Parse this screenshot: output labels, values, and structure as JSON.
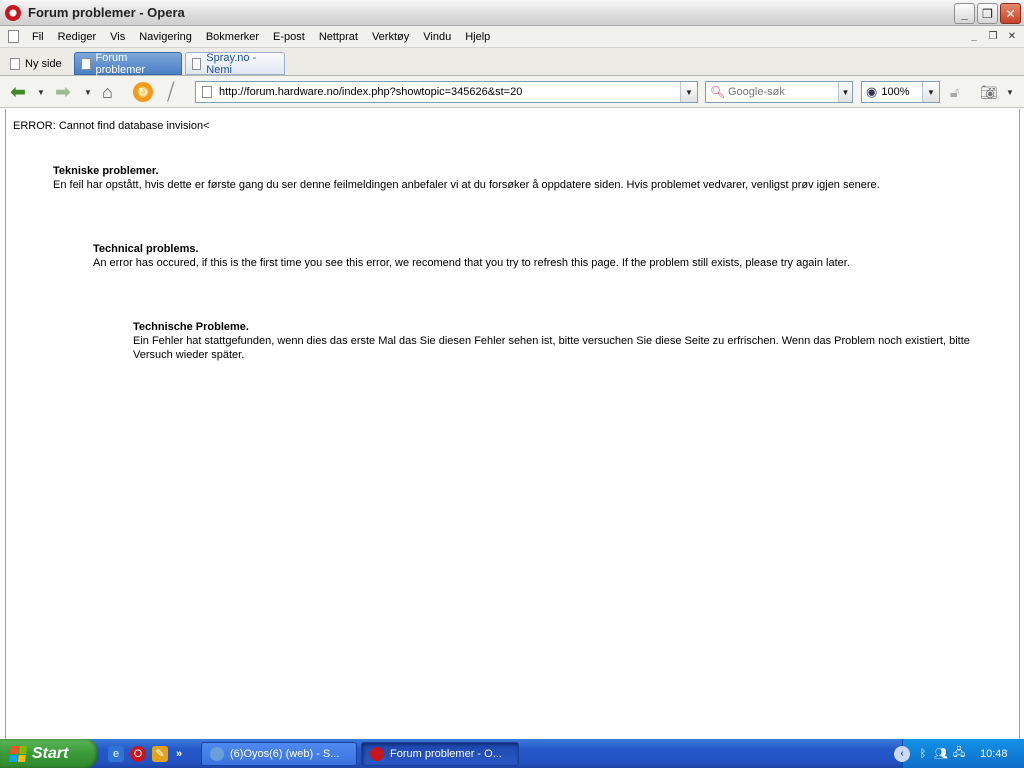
{
  "window": {
    "title": "Forum problemer - Opera"
  },
  "menu": {
    "items": [
      "Fil",
      "Rediger",
      "Vis",
      "Navigering",
      "Bokmerker",
      "E-post",
      "Nettprat",
      "Verktøy",
      "Vindu",
      "Hjelp"
    ]
  },
  "tabs": {
    "new_page": "Ny side",
    "active": "Forum problemer",
    "inactive": "Spray.no - Nemi"
  },
  "toolbar": {
    "url": "http://forum.hardware.no/index.php?showtopic=345626&st=20",
    "search_placeholder": "Google-søk",
    "zoom": "100%"
  },
  "page": {
    "error_line": "ERROR: Cannot find database invision<",
    "messages": [
      {
        "title": "Tekniske problemer.",
        "body": "En feil har opstått, hvis dette er første gang du ser denne feilmeldingen anbefaler vi at du forsøker å oppdatere siden. Hvis problemet vedvarer, venligst prøv igjen senere."
      },
      {
        "title": "Technical problems.",
        "body": "An error has occured, if this is the first time you see this error, we recomend that you try to refresh this page. If the problem still exists, please try again later."
      },
      {
        "title": "Technische Probleme.",
        "body": "Ein Fehler hat stattgefunden, wenn dies das erste Mal das Sie diesen Fehler sehen ist, bitte versuchen Sie diese Seite zu erfrischen. Wenn das Problem noch existiert, bitte Versuch wieder später."
      }
    ]
  },
  "taskbar": {
    "start_label": "Start",
    "tasks": [
      "(6)Oyos(6) (web) - S...",
      "Forum problemer - O..."
    ],
    "clock": "10:48"
  }
}
